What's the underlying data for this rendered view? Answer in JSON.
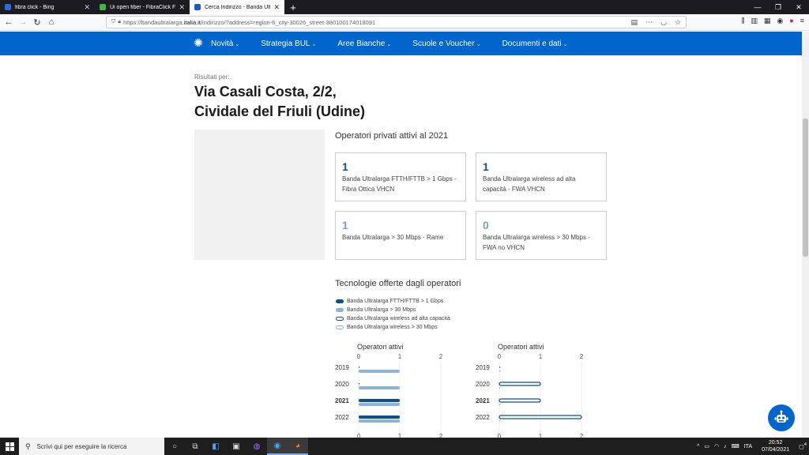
{
  "browser": {
    "tabs": [
      {
        "title": "fibra click - Bing",
        "color": "#2f6bd8"
      },
      {
        "title": "Ui open fiber - FibraClick Forum",
        "color": "#3cb44a"
      },
      {
        "title": "Cerca Indirizzo - Banda Ultra Larga",
        "color": "#1e5bb8"
      }
    ],
    "active_tab": 2,
    "url_prefix": "https://bandaultralarga.",
    "url_domain": "italia.it",
    "url_suffix": "/indirizzo/?address=region-6_city-30026_street-380100174018091"
  },
  "site": {
    "menu": [
      "Novità",
      "Strategia BUL",
      "Aree Bianche",
      "Scuole e Voucher",
      "Documenti e dati"
    ],
    "brand_color": "#0066cc"
  },
  "results": {
    "label": "Risultati per:",
    "address_line1": "Via Casali Costa, 2/2,",
    "address_line2": "Cividale del Friuli (Udine)"
  },
  "operators": {
    "title": "Operatori privati attivi al 2021",
    "cards": [
      {
        "value": "1",
        "desc": "Banda Ultralarga FTTH/FTTB > 1 Gbps - Fibra Ottica VHCN"
      },
      {
        "value": "1",
        "desc": "Banda Ultralarga wireless ad alta capacità - FWA VHCN"
      },
      {
        "value": "1",
        "desc": "Banda Ultralarga > 30 Mbps - Rame"
      },
      {
        "value": "0",
        "desc": "Banda Ultralarga wireless > 30 Mbps - FWA no VHCN"
      }
    ]
  },
  "technologies": {
    "title": "Tecnologie offerte dagli operatori",
    "legend": [
      {
        "label": "Banda Ultralarga FTTH/FTTB > 1 Gbps",
        "style": "dark"
      },
      {
        "label": "Banda Ultralarga > 30 Mbps",
        "style": "light"
      },
      {
        "label": "Banda Ultralarga wireless ad alta capacità",
        "style": "dark-outline"
      },
      {
        "label": "Banda Ultralarga wireless > 30 Mbps",
        "style": "light-outline"
      }
    ],
    "colors": {
      "dark": "#0b4f8e",
      "light": "#8db4d8"
    }
  },
  "chart_data": [
    {
      "type": "bar",
      "title": "Operatori attivi",
      "categories": [
        "2019",
        "2020",
        "2021",
        "2022"
      ],
      "highlight": "2021",
      "xlim": [
        0,
        2
      ],
      "ticks": [
        "0",
        "1",
        "2"
      ],
      "series": [
        {
          "name": "Banda Ultralarga FTTH/FTTB > 1 Gbps",
          "style": "dark",
          "values": [
            0,
            0,
            1,
            1
          ]
        },
        {
          "name": "Banda Ultralarga > 30 Mbps",
          "style": "light",
          "values": [
            1,
            1,
            1,
            1
          ]
        }
      ]
    },
    {
      "type": "bar",
      "title": "Operatori attivi",
      "categories": [
        "2019",
        "2020",
        "2021",
        "2022"
      ],
      "highlight": "2021",
      "xlim": [
        0,
        2
      ],
      "ticks": [
        "0",
        "1",
        "2"
      ],
      "series": [
        {
          "name": "Banda Ultralarga wireless ad alta capacità",
          "style": "dark-outline",
          "values": [
            0,
            1,
            1,
            2
          ]
        },
        {
          "name": "Banda Ultralarga wireless > 30 Mbps",
          "style": "light-outline",
          "values": [
            0,
            0,
            0,
            0
          ]
        }
      ]
    }
  ],
  "taskbar": {
    "search_placeholder": "Scrivi qui per eseguire la ricerca",
    "lang": "ITA",
    "time": "20:52",
    "date": "07/04/2021",
    "notifications": "4"
  }
}
